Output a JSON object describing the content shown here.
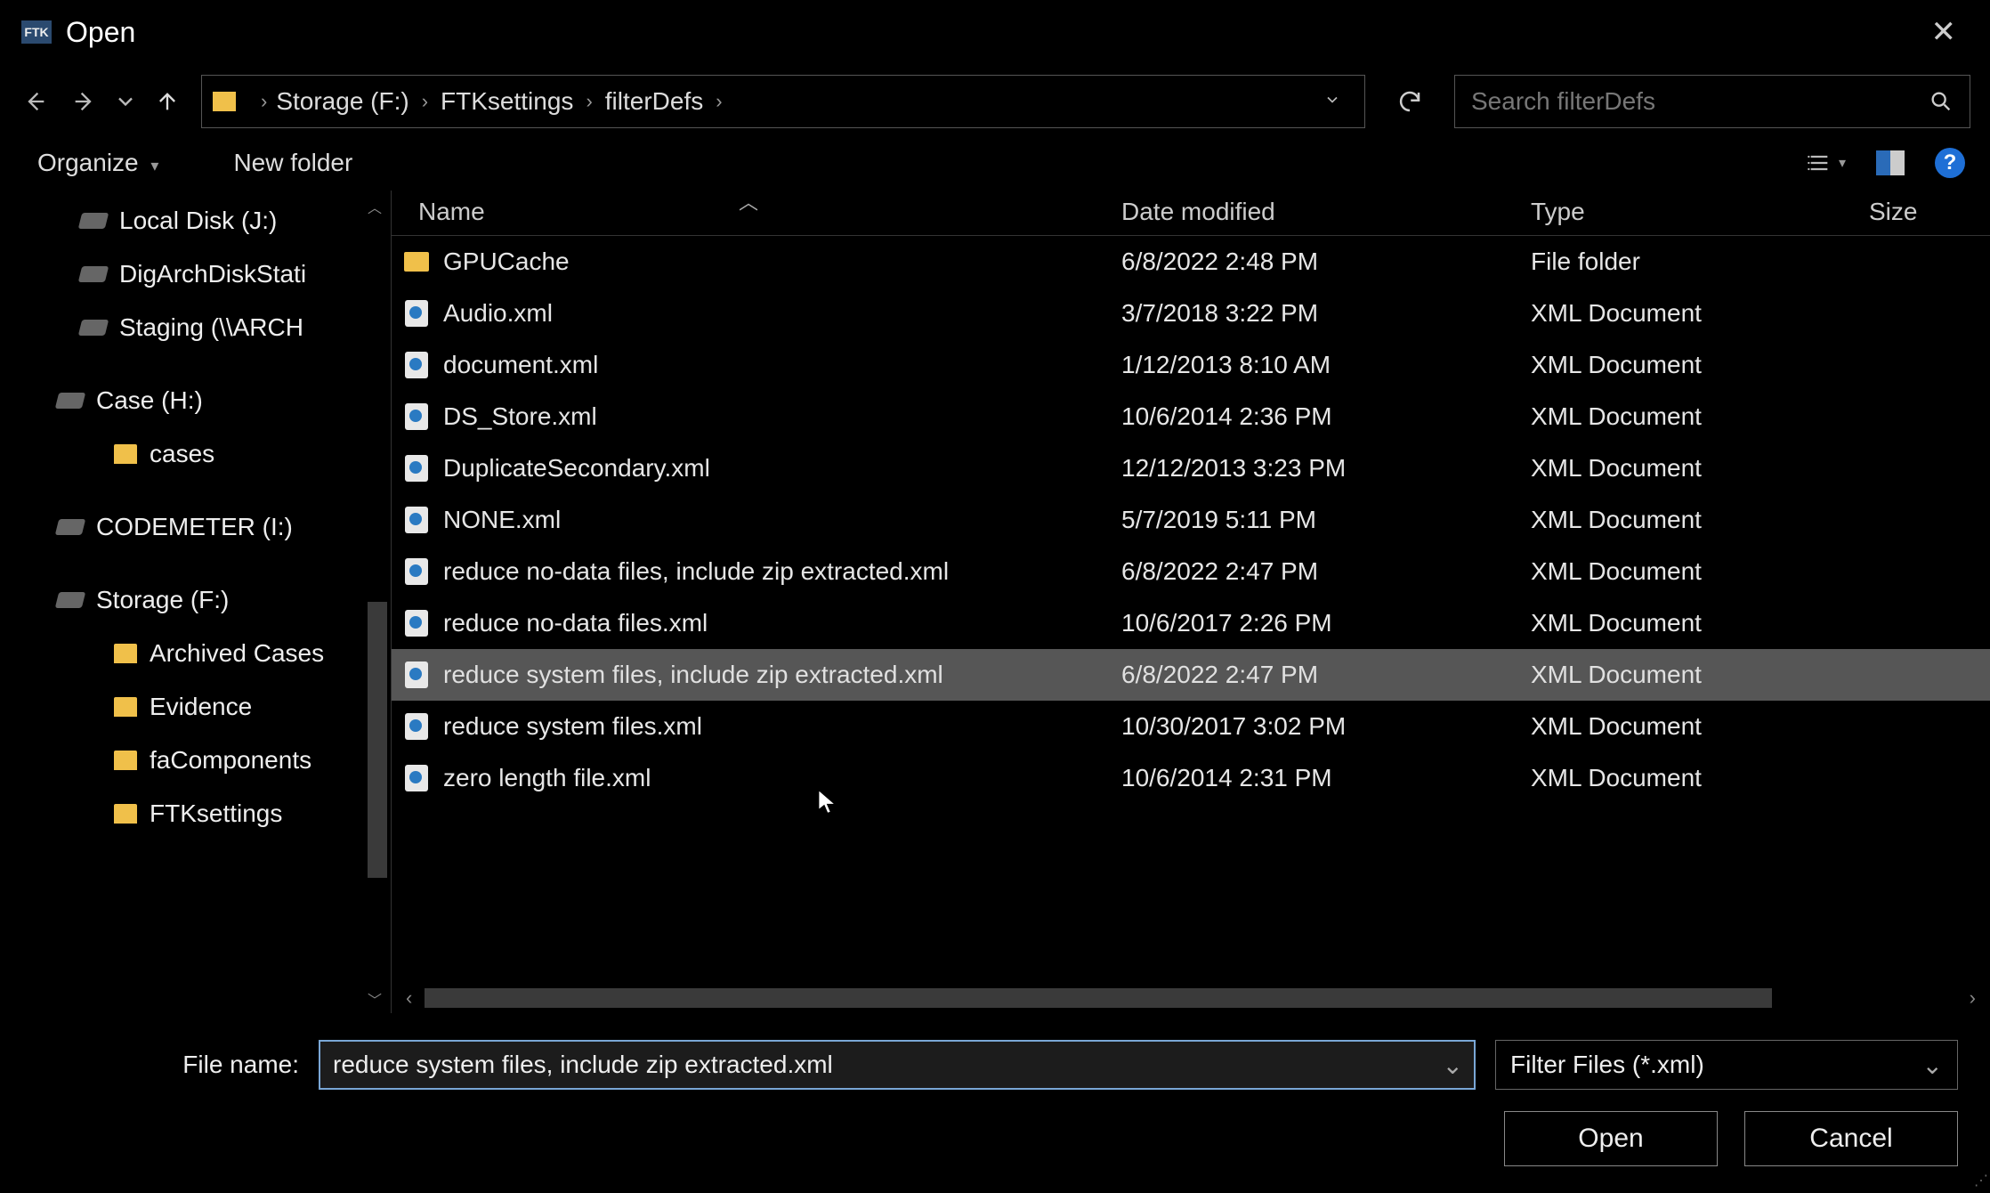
{
  "window": {
    "title": "Open",
    "app_badge": "FTK"
  },
  "breadcrumb": {
    "parts": [
      "Storage (F:)",
      "FTKsettings",
      "filterDefs"
    ]
  },
  "search": {
    "placeholder": "Search filterDefs"
  },
  "toolbar": {
    "organize": "Organize",
    "new_folder": "New folder"
  },
  "tree": {
    "drive_j": "Local Disk (J:)",
    "digarch": "DigArchDiskStati",
    "staging": "Staging (\\\\ARCH",
    "case_h": "Case (H:)",
    "cases": "cases",
    "codemeter": "CODEMETER (I:)",
    "storage_f": "Storage (F:)",
    "archived": "Archived Cases",
    "evidence": "Evidence",
    "facomp": "faComponents",
    "ftksettings": "FTKsettings"
  },
  "columns": {
    "name": "Name",
    "date": "Date modified",
    "type": "Type",
    "size": "Size"
  },
  "files": [
    {
      "name": "GPUCache",
      "date": "6/8/2022 2:48 PM",
      "type": "File folder",
      "kind": "folder"
    },
    {
      "name": "Audio.xml",
      "date": "3/7/2018 3:22 PM",
      "type": "XML Document",
      "kind": "xml"
    },
    {
      "name": "document.xml",
      "date": "1/12/2013 8:10 AM",
      "type": "XML Document",
      "kind": "xml"
    },
    {
      "name": "DS_Store.xml",
      "date": "10/6/2014 2:36 PM",
      "type": "XML Document",
      "kind": "xml"
    },
    {
      "name": "DuplicateSecondary.xml",
      "date": "12/12/2013 3:23 PM",
      "type": "XML Document",
      "kind": "xml"
    },
    {
      "name": "NONE.xml",
      "date": "5/7/2019 5:11 PM",
      "type": "XML Document",
      "kind": "xml"
    },
    {
      "name": "reduce no-data files, include zip extracted.xml",
      "date": "6/8/2022 2:47 PM",
      "type": "XML Document",
      "kind": "xml"
    },
    {
      "name": "reduce no-data files.xml",
      "date": "10/6/2017 2:26 PM",
      "type": "XML Document",
      "kind": "xml"
    },
    {
      "name": "reduce system files, include zip extracted.xml",
      "date": "6/8/2022 2:47 PM",
      "type": "XML Document",
      "kind": "xml",
      "selected": true
    },
    {
      "name": "reduce system files.xml",
      "date": "10/30/2017 3:02 PM",
      "type": "XML Document",
      "kind": "xml"
    },
    {
      "name": "zero length file.xml",
      "date": "10/6/2014 2:31 PM",
      "type": "XML Document",
      "kind": "xml"
    }
  ],
  "footer": {
    "filename_label": "File name:",
    "filename_value": "reduce system files, include zip extracted.xml",
    "filter": "Filter Files (*.xml)",
    "open": "Open",
    "cancel": "Cancel"
  }
}
